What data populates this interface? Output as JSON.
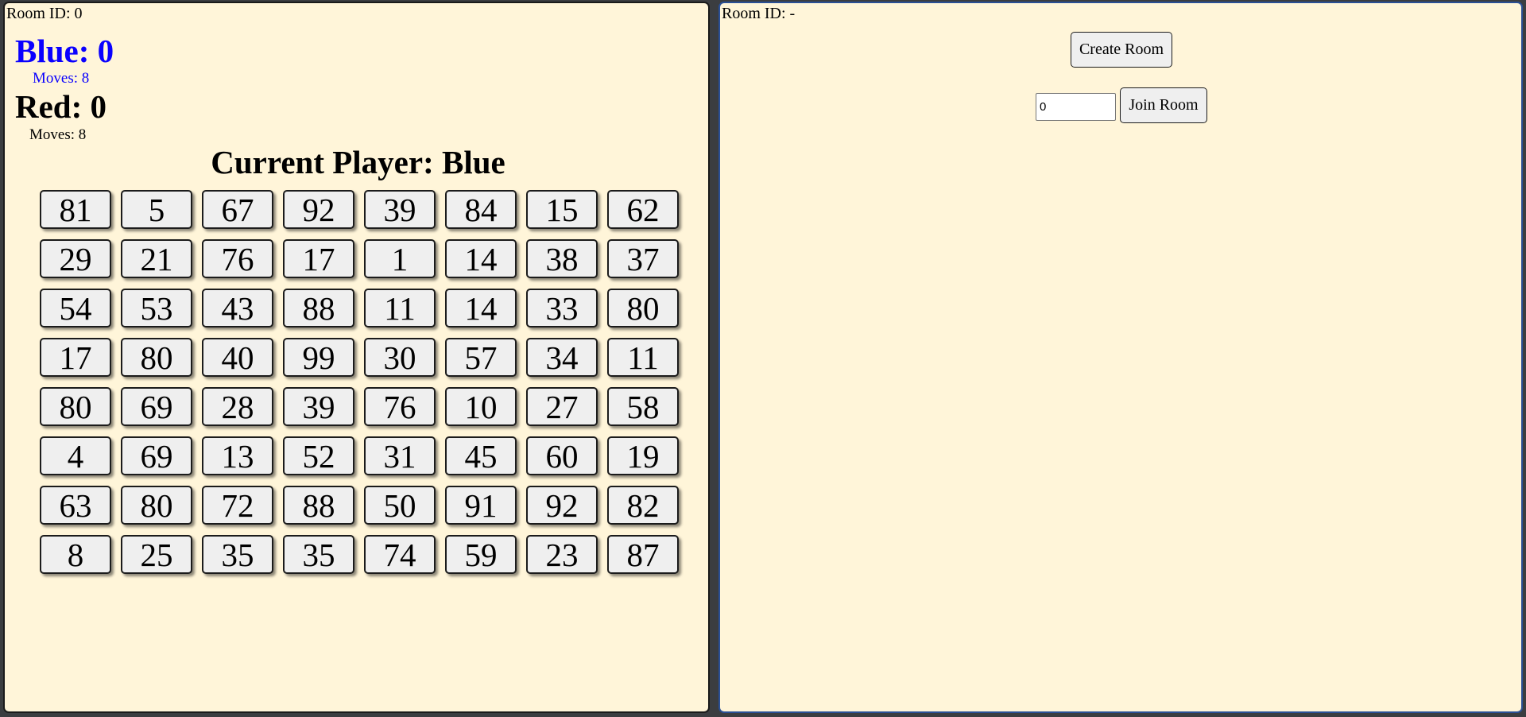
{
  "left_panel": {
    "room_id": "Room ID: 0",
    "blue": {
      "score": "Blue: 0",
      "moves": "Moves: 8",
      "color": "#0a00ff"
    },
    "red": {
      "score": "Red: 0",
      "moves": "Moves: 8",
      "color": "#000000"
    },
    "current_player": "Current Player: Blue",
    "grid": [
      [
        "81",
        "5",
        "67",
        "92",
        "39",
        "84",
        "15",
        "62"
      ],
      [
        "29",
        "21",
        "76",
        "17",
        "1",
        "14",
        "38",
        "37"
      ],
      [
        "54",
        "53",
        "43",
        "88",
        "11",
        "14",
        "33",
        "80"
      ],
      [
        "17",
        "80",
        "40",
        "99",
        "30",
        "57",
        "34",
        "11"
      ],
      [
        "80",
        "69",
        "28",
        "39",
        "76",
        "10",
        "27",
        "58"
      ],
      [
        "4",
        "69",
        "13",
        "52",
        "31",
        "45",
        "60",
        "19"
      ],
      [
        "63",
        "80",
        "72",
        "88",
        "50",
        "91",
        "92",
        "82"
      ],
      [
        "8",
        "25",
        "35",
        "35",
        "74",
        "59",
        "23",
        "87"
      ]
    ]
  },
  "right_panel": {
    "room_id": "Room ID: -",
    "create_room_label": "Create Room",
    "join_room_label": "Join Room",
    "room_input_value": "0"
  },
  "colors": {
    "panel_background": "#fff5d9",
    "page_background": "#3b3d40",
    "cell_background": "#efefef"
  }
}
